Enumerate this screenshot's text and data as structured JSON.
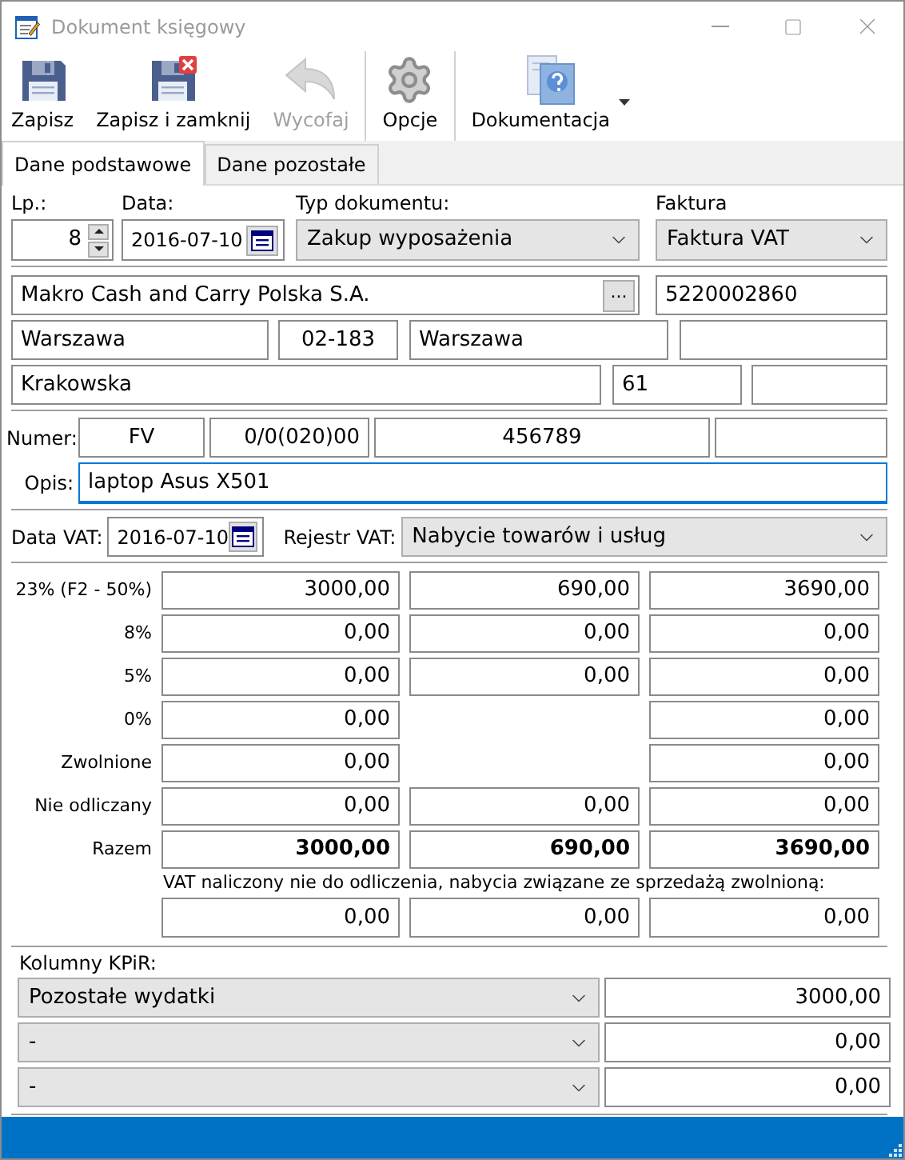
{
  "window": {
    "title": "Dokument księgowy"
  },
  "toolbar": [
    [
      {
        "label": "Zapisz",
        "kind": "save",
        "disabled": false,
        "has_menu": false
      },
      {
        "label": "Zapisz i zamknij",
        "kind": "save-close",
        "disabled": false,
        "has_menu": false
      },
      {
        "label": "Wycofaj",
        "kind": "undo",
        "disabled": true,
        "has_menu": false
      }
    ],
    [
      {
        "label": "Opcje",
        "kind": "gear",
        "disabled": false,
        "has_menu": false
      }
    ],
    [
      {
        "label": "Dokumentacja",
        "kind": "help",
        "disabled": false,
        "has_menu": true
      }
    ]
  ],
  "tabs": [
    {
      "label": "Dane podstawowe",
      "selected": true
    },
    {
      "label": "Dane pozostałe",
      "selected": false
    }
  ],
  "header": {
    "lp_label": "Lp.:",
    "lp": "8",
    "date_label": "Data:",
    "date": "2016-07-10",
    "type_label": "Typ dokumentu:",
    "type": "Zakup wyposażenia",
    "invoice_label": "Faktura",
    "invoice": "Faktura VAT"
  },
  "contractor": {
    "name": "Makro Cash and Carry Polska S.A.",
    "browse": "...",
    "nip": "5220002860",
    "city": "Warszawa",
    "postal_code": "02-183",
    "post_office": "Warszawa",
    "street": "Krakowska",
    "house_number": "61"
  },
  "number": {
    "label": "Numer:",
    "parts": [
      "FV",
      "0/0(020)00",
      "456789"
    ]
  },
  "description": {
    "label": "Opis:",
    "value": "laptop Asus X501",
    "focused": true
  },
  "vat_date": {
    "label": "Data VAT:",
    "value": "2016-07-10"
  },
  "vat_register": {
    "label": "Rejestr VAT:",
    "value": "Nabycie towarów i usług"
  },
  "vat_rows": [
    {
      "kind": "rate",
      "label": "23% (F2 - 50%)",
      "net": "3000,00",
      "vat": "690,00",
      "gross": "3690,00"
    },
    {
      "kind": "rate",
      "label": "8%",
      "net": "0,00",
      "vat": "0,00",
      "gross": "0,00"
    },
    {
      "kind": "rate",
      "label": "5%",
      "net": "0,00",
      "vat": "0,00",
      "gross": "0,00"
    },
    {
      "kind": "rate",
      "label": "0%",
      "net": "0,00",
      "gross": "0,00"
    },
    {
      "kind": "rate",
      "label": "Zwolnione",
      "net": "0,00",
      "gross": "0,00"
    },
    {
      "kind": "rate",
      "label": "Nie odliczany",
      "net": "0,00",
      "vat": "0,00",
      "gross": "0,00"
    },
    {
      "kind": "total",
      "label": "Razem",
      "net": "3000,00",
      "vat": "690,00",
      "gross": "3690,00"
    }
  ],
  "non_deductible": {
    "label": "VAT naliczony nie do odliczenia, nabycia związane ze sprzedażą zwolnioną:",
    "values": [
      "0,00",
      "0,00",
      "0,00"
    ]
  },
  "kpir": {
    "label": "Kolumny KPiR:",
    "rows": [
      {
        "column": "Pozostałe wydatki",
        "amount": "3000,00"
      },
      {
        "column": "-",
        "amount": "0,00"
      },
      {
        "column": "-",
        "amount": "0,00"
      }
    ]
  }
}
